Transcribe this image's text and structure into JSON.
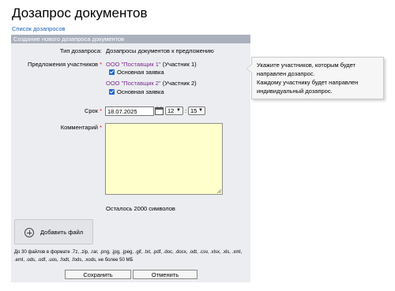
{
  "page": {
    "title": "Дозапрос документов"
  },
  "breadcrumb": {
    "link": "Список дозапросов"
  },
  "form": {
    "header": "Создание нового дозапроса документов",
    "type": {
      "label": "Тип дозапроса:",
      "value": "Дозапросы документов к предложению"
    },
    "participants": {
      "label": "Предложения участников",
      "required_mark": "*",
      "items": [
        {
          "name": "ООО \"Поставщик 1\"",
          "tag": "(Участник 1)",
          "checkbox_label": "Основная заявка",
          "checked": true
        },
        {
          "name": "ООО \"Поставщик 2\"",
          "tag": "(Участник 2)",
          "checkbox_label": "Основная заявка",
          "checked": true
        }
      ]
    },
    "deadline": {
      "label": "Срок",
      "required_mark": "*",
      "date": "18.07.2025",
      "hour": "12",
      "minute": "15",
      "separator": ":"
    },
    "comment": {
      "label": "Комментарий",
      "required_mark": "*",
      "value": "",
      "counter": "Осталось 2000 символов"
    },
    "attach": {
      "button_label": "Добавить файл",
      "hint": "До 30 файлов в формате .7z, .zip, .rar, .png, .jpg, .jpeg, .gif, .txt, .pdf, .doc, .docx, .odt, .csv, .xlsx, .xls, .xml, .eml, .ods, .odf, .uos, .fodt, .fods, .xods, не более 50 МБ"
    },
    "actions": {
      "save": "Сохранить",
      "cancel": "Отменить"
    }
  },
  "tooltip": {
    "lines": [
      "Укажите участников, которым будет",
      "направлен дозапрос.",
      "Каждому участнику будет направлен",
      "индивидуальный дозапрос."
    ]
  },
  "colors": {
    "header_bg": "#aab1bd",
    "panel_bg": "#ecedf0",
    "link": "#1a5fb4",
    "supplier": "#7a2b8f",
    "required": "#dd1111",
    "textarea_bg": "#ffffcc",
    "checkbox": "#1e66c9"
  },
  "icons": [
    "calendar-icon",
    "plus-circle-icon",
    "chevron-down-icon",
    "resize-handle-icon"
  ]
}
